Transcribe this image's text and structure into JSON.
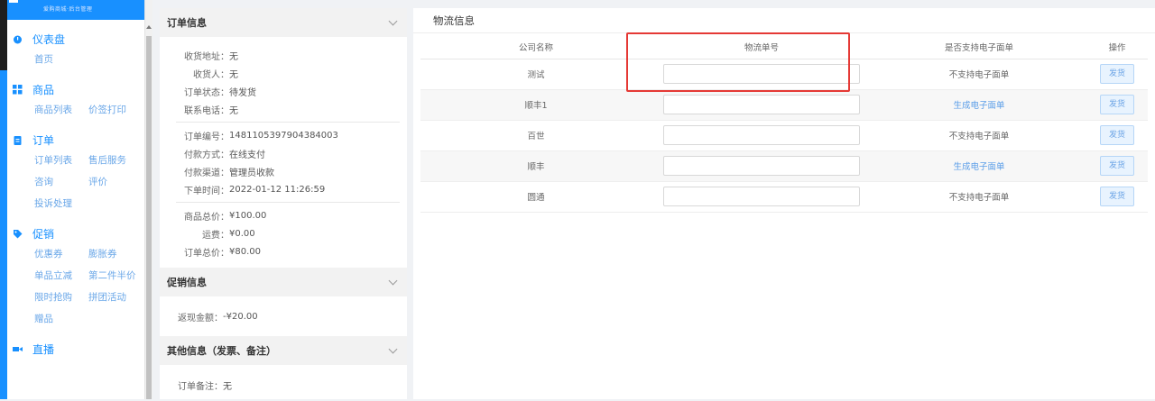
{
  "sidebar": {
    "logo_text": "爱购商城·后台管理",
    "groups": [
      {
        "title": "仪表盘",
        "icon": "dashboard-icon",
        "items": [
          "首页"
        ]
      },
      {
        "title": "商品",
        "icon": "grid-icon",
        "items": [
          "商品列表",
          "价签打印"
        ]
      },
      {
        "title": "订单",
        "icon": "clipboard-icon",
        "items": [
          "订单列表",
          "售后服务",
          "咨询",
          "评价",
          "投诉处理"
        ]
      },
      {
        "title": "促销",
        "icon": "tag-icon",
        "items": [
          "优惠券",
          "膨胀券",
          "单品立减",
          "第二件半价",
          "限时抢购",
          "拼团活动",
          "赠品"
        ]
      },
      {
        "title": "直播",
        "icon": "video-icon",
        "items": []
      }
    ]
  },
  "order_info": {
    "header": "订单信息",
    "address_label": "收货地址：",
    "address": "无",
    "receiver_label": "收货人：",
    "receiver": "无",
    "status_label": "订单状态：",
    "status": "待发货",
    "phone_label": "联系电话：",
    "phone": "无",
    "order_no_label": "订单编号：",
    "order_no": "1481105397904384003",
    "pay_method_label": "付款方式：",
    "pay_method": "在线支付",
    "pay_channel_label": "付款渠道：",
    "pay_channel": "管理员收款",
    "order_time_label": "下单时间：",
    "order_time": "2022-01-12 11:26:59",
    "goods_total_label": "商品总价：",
    "goods_total": "¥100.00",
    "freight_label": "运费：",
    "freight": "¥0.00",
    "order_total_label": "订单总价：",
    "order_total": "¥80.00"
  },
  "promo_info": {
    "header": "促销信息",
    "cashback_label": "返现金额：",
    "cashback": "-¥20.00"
  },
  "other_info": {
    "header": "其他信息（发票、备注）",
    "remark_label": "订单备注：",
    "remark": "无"
  },
  "logistics": {
    "title": "物流信息",
    "columns": [
      "公司名称",
      "物流单号",
      "是否支持电子面单",
      "操作"
    ],
    "rows": [
      {
        "company": "测试",
        "tracking_no": "",
        "e_waybill": "不支持电子面单",
        "e_waybill_link": false,
        "action": "发货"
      },
      {
        "company": "顺丰1",
        "tracking_no": "",
        "e_waybill": "生成电子面单",
        "e_waybill_link": true,
        "action": "发货"
      },
      {
        "company": "百世",
        "tracking_no": "",
        "e_waybill": "不支持电子面单",
        "e_waybill_link": false,
        "action": "发货"
      },
      {
        "company": "顺丰",
        "tracking_no": "",
        "e_waybill": "生成电子面单",
        "e_waybill_link": true,
        "action": "发货"
      },
      {
        "company": "圆通",
        "tracking_no": "",
        "e_waybill": "不支持电子面单",
        "e_waybill_link": false,
        "action": "发货"
      }
    ]
  },
  "colors": {
    "accent": "#1890ff",
    "highlight": "#e53935",
    "link": "#5b9ee8"
  }
}
